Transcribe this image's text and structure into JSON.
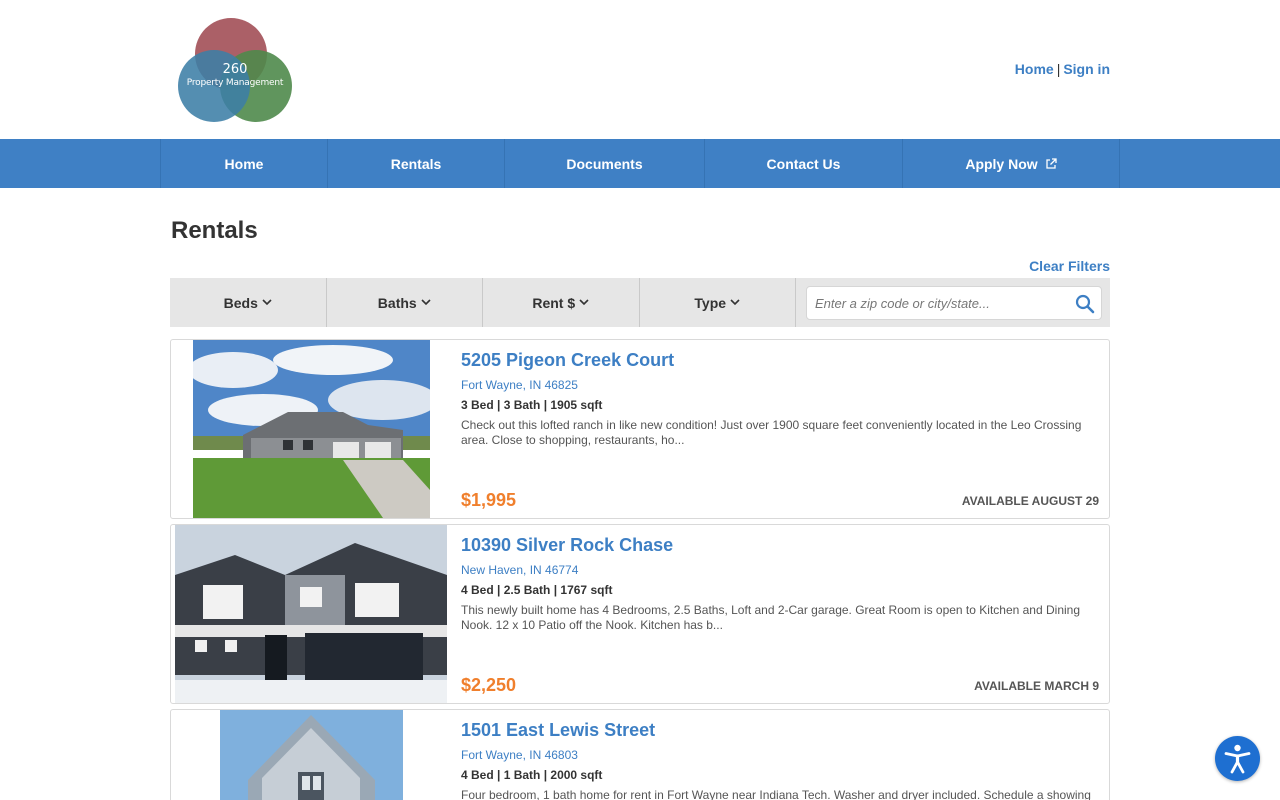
{
  "brand": {
    "logo_number": "260",
    "logo_sub": "Property Management"
  },
  "top_links": {
    "home": "Home",
    "separator": "|",
    "sign_in": "Sign in"
  },
  "nav": [
    {
      "label": "Home"
    },
    {
      "label": "Rentals"
    },
    {
      "label": "Documents"
    },
    {
      "label": "Contact Us"
    },
    {
      "label": "Apply Now"
    }
  ],
  "page": {
    "title": "Rentals",
    "clear_filters": "Clear Filters"
  },
  "filters": [
    {
      "label": "Beds"
    },
    {
      "label": "Baths"
    },
    {
      "label": "Rent $"
    },
    {
      "label": "Type"
    }
  ],
  "search": {
    "placeholder": "Enter a zip code or city/state..."
  },
  "listings": [
    {
      "address": "5205 Pigeon Creek Court",
      "city": "Fort Wayne, IN 46825",
      "specs": "3 Bed | 3 Bath | 1905 sqft",
      "description": "Check out this lofted ranch in like new condition! Just over 1900 square feet conveniently located in the Leo Crossing area. Close to shopping, restaurants, ho...",
      "price": "$1,995",
      "availability": "AVAILABLE AUGUST 29"
    },
    {
      "address": "10390 Silver Rock Chase",
      "city": "New Haven, IN 46774",
      "specs": "4 Bed | 2.5 Bath | 1767 sqft",
      "description": "This newly built home has 4 Bedrooms, 2.5 Baths, Loft and 2-Car garage. Great Room is open to Kitchen and Dining Nook. 12 x 10 Patio off the Nook. Kitchen has b...",
      "price": "$2,250",
      "availability": "AVAILABLE MARCH 9"
    },
    {
      "address": "1501 East Lewis Street",
      "city": "Fort Wayne, IN 46803",
      "specs": "4 Bed | 1 Bath | 2000 sqft",
      "description": "Four bedroom, 1 bath home for rent in Fort Wayne near Indiana Tech. Washer and dryer included. Schedule a showing",
      "price": "",
      "availability": ""
    }
  ],
  "colors": {
    "accent": "#3f80c5",
    "link": "#3d7fc4",
    "price": "#f07f2c"
  }
}
